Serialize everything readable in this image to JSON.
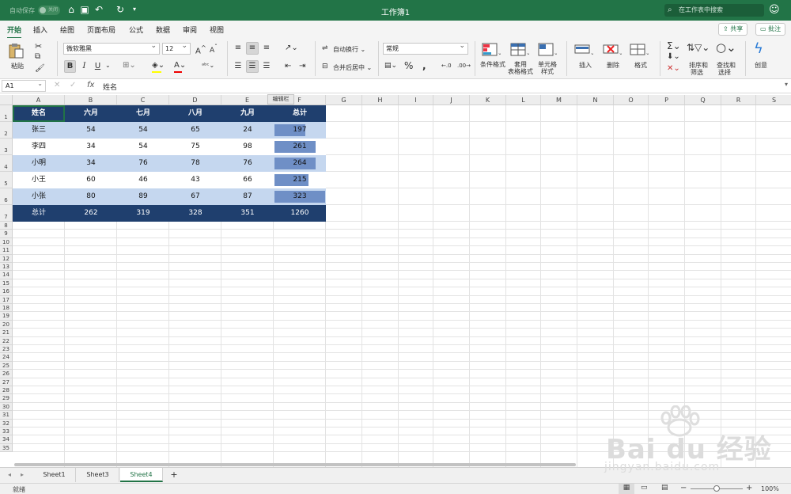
{
  "titlebar": {
    "autosave_label": "自动保存",
    "autosave_state": "关闭",
    "title": "工作簿1",
    "search_placeholder": "在工作表中搜索"
  },
  "tabs": [
    "开始",
    "插入",
    "绘图",
    "页面布局",
    "公式",
    "数据",
    "审阅",
    "视图"
  ],
  "share_label": "共享",
  "comment_label": "批注",
  "ribbon": {
    "paste": "粘贴",
    "font_name": "微软雅黑",
    "font_size": "12",
    "bold": "B",
    "italic": "I",
    "underline": "U",
    "wrap_text": "自动换行",
    "merge_center": "合并后居中",
    "number_format": "常规",
    "conditional_format": "条件格式",
    "table_format": [
      "套用",
      "表格格式"
    ],
    "cell_style": [
      "单元格",
      "样式"
    ],
    "insert": "插入",
    "delete": "删除",
    "format": "格式",
    "sort_filter": [
      "排序和",
      "筛选"
    ],
    "find_select": [
      "查找和",
      "选择"
    ],
    "ideas": "创意"
  },
  "formula": {
    "name_box": "A1",
    "fx": "fx",
    "content": "姓名",
    "tooltip": "编辑栏"
  },
  "columns": [
    "A",
    "B",
    "C",
    "D",
    "E",
    "F",
    "G",
    "H",
    "I",
    "J",
    "K",
    "L",
    "M",
    "N",
    "O",
    "P",
    "Q",
    "R",
    "S"
  ],
  "rows": [
    "1",
    "2",
    "3",
    "4",
    "5",
    "6",
    "7",
    "8",
    "9",
    "10",
    "11",
    "12",
    "13",
    "14",
    "15",
    "16",
    "17",
    "18",
    "19",
    "20",
    "21",
    "22",
    "23",
    "24",
    "25",
    "26",
    "27",
    "28",
    "29",
    "30",
    "31",
    "32",
    "33",
    "34",
    "35"
  ],
  "table": {
    "headers": [
      "姓名",
      "六月",
      "七月",
      "八月",
      "九月",
      "总计"
    ],
    "rows": [
      [
        "张三",
        "54",
        "54",
        "65",
        "24",
        "197"
      ],
      [
        "李四",
        "34",
        "54",
        "75",
        "98",
        "261"
      ],
      [
        "小明",
        "34",
        "76",
        "78",
        "76",
        "264"
      ],
      [
        "小王",
        "60",
        "46",
        "43",
        "66",
        "215"
      ],
      [
        "小张",
        "80",
        "89",
        "67",
        "87",
        "323"
      ]
    ],
    "totals": [
      "总计",
      "262",
      "319",
      "328",
      "351",
      "1260"
    ],
    "databar_values": [
      197,
      261,
      264,
      215,
      323
    ],
    "databar_max": 323,
    "colors": {
      "header": "#1f3f6e",
      "band": "#c5d7ef",
      "databar": "#6f8fc6"
    }
  },
  "sheets": [
    "Sheet1",
    "Sheet3",
    "Sheet4"
  ],
  "active_sheet": "Sheet4",
  "status": {
    "ready": "就绪",
    "zoom": "100%"
  },
  "watermark": {
    "brand": "Bai du 经验",
    "url": "jingyan.baidu.com"
  }
}
